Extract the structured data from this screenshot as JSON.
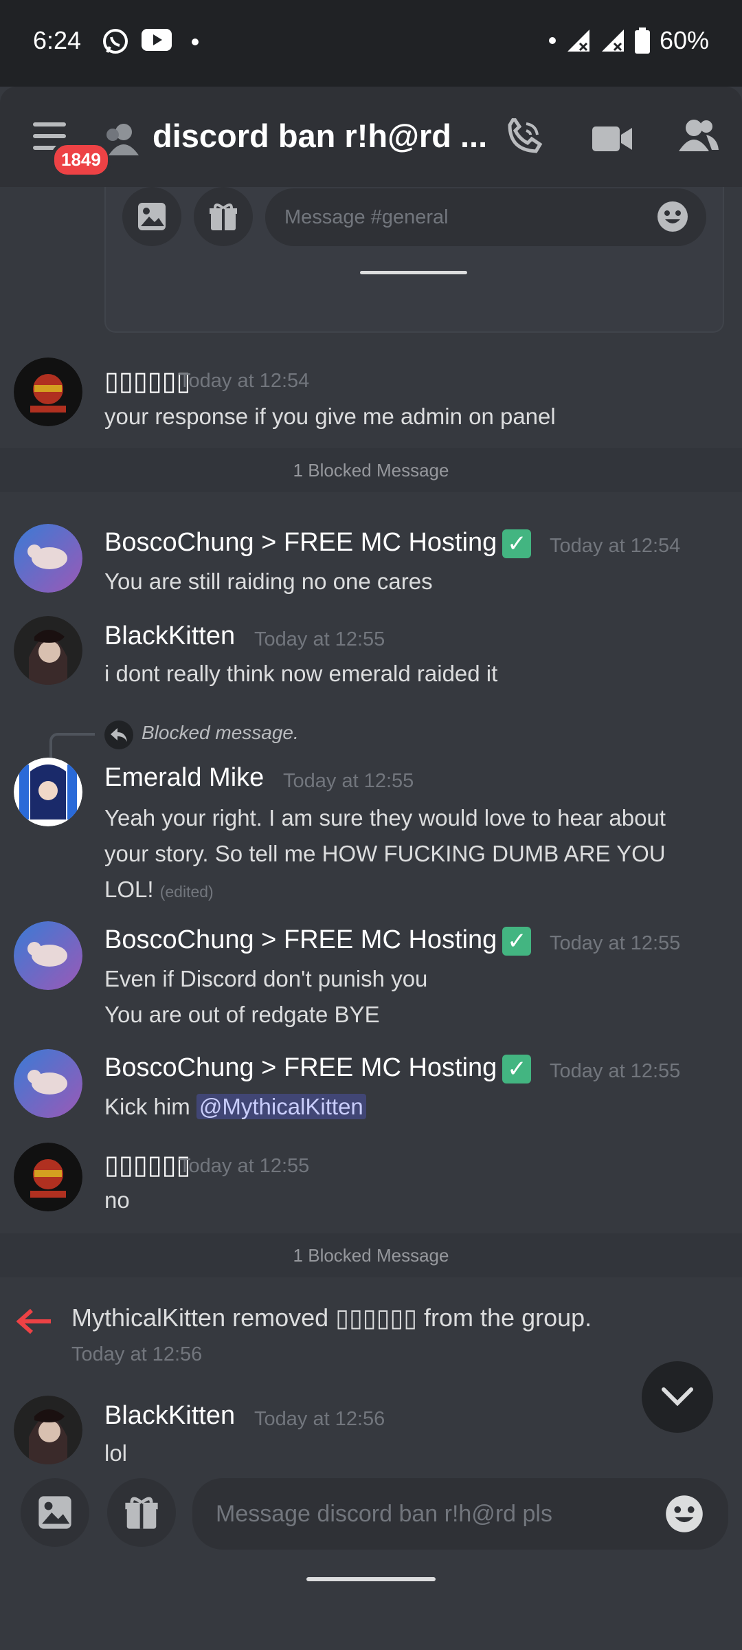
{
  "status_bar": {
    "time": "6:24",
    "battery": "60%"
  },
  "header": {
    "title": "discord ban r!h@rd ...",
    "badge_count": "1849"
  },
  "top_composer": {
    "placeholder": "Message #general"
  },
  "messages": [
    {
      "author": "▯▯▯▯▯▯",
      "time": "Today at 12:54",
      "lines": [
        "your response if you give me admin on panel"
      ]
    },
    {
      "author": "BoscoChung > FREE MC Hosting",
      "time": "Today at 12:54",
      "lines": [
        "You are still raiding no one cares"
      ]
    },
    {
      "author": "BlackKitten",
      "time": "Today at 12:55",
      "lines": [
        "i dont really think now emerald raided it"
      ]
    },
    {
      "author": "Emerald Mike",
      "time": "Today at 12:55",
      "reply": "Blocked message.",
      "lines": [
        "Yeah your right. I am sure they would love to hear about",
        "your story. So tell me HOW FUCKING DUMB ARE YOU",
        "LOL!"
      ],
      "edited": "(edited)"
    },
    {
      "author": "BoscoChung > FREE MC Hosting",
      "time": "Today at 12:55",
      "lines": [
        "Even if Discord don't punish you",
        "You are out of redgate BYE"
      ]
    },
    {
      "author": "BoscoChung > FREE MC Hosting",
      "time": "Today at 12:55",
      "prefix": "Kick him ",
      "mention": "@MythicalKitten"
    },
    {
      "author": "▯▯▯▯▯▯",
      "time": "Today at 12:55",
      "lines": [
        "no"
      ]
    },
    {
      "author": "BlackKitten",
      "time": "Today at 12:56",
      "lines": [
        "lol"
      ]
    }
  ],
  "blocked": {
    "label": "1 Blocked Message"
  },
  "system": {
    "text": "MythicalKitten removed ▯▯▯▯▯▯ from the group.",
    "time": "Today at 12:56"
  },
  "composer": {
    "placeholder": "Message discord ban r!h@rd pls"
  },
  "colors": {
    "accent_red": "#ed4245",
    "verified_green": "#43b581",
    "mention_bg": "#414675"
  }
}
